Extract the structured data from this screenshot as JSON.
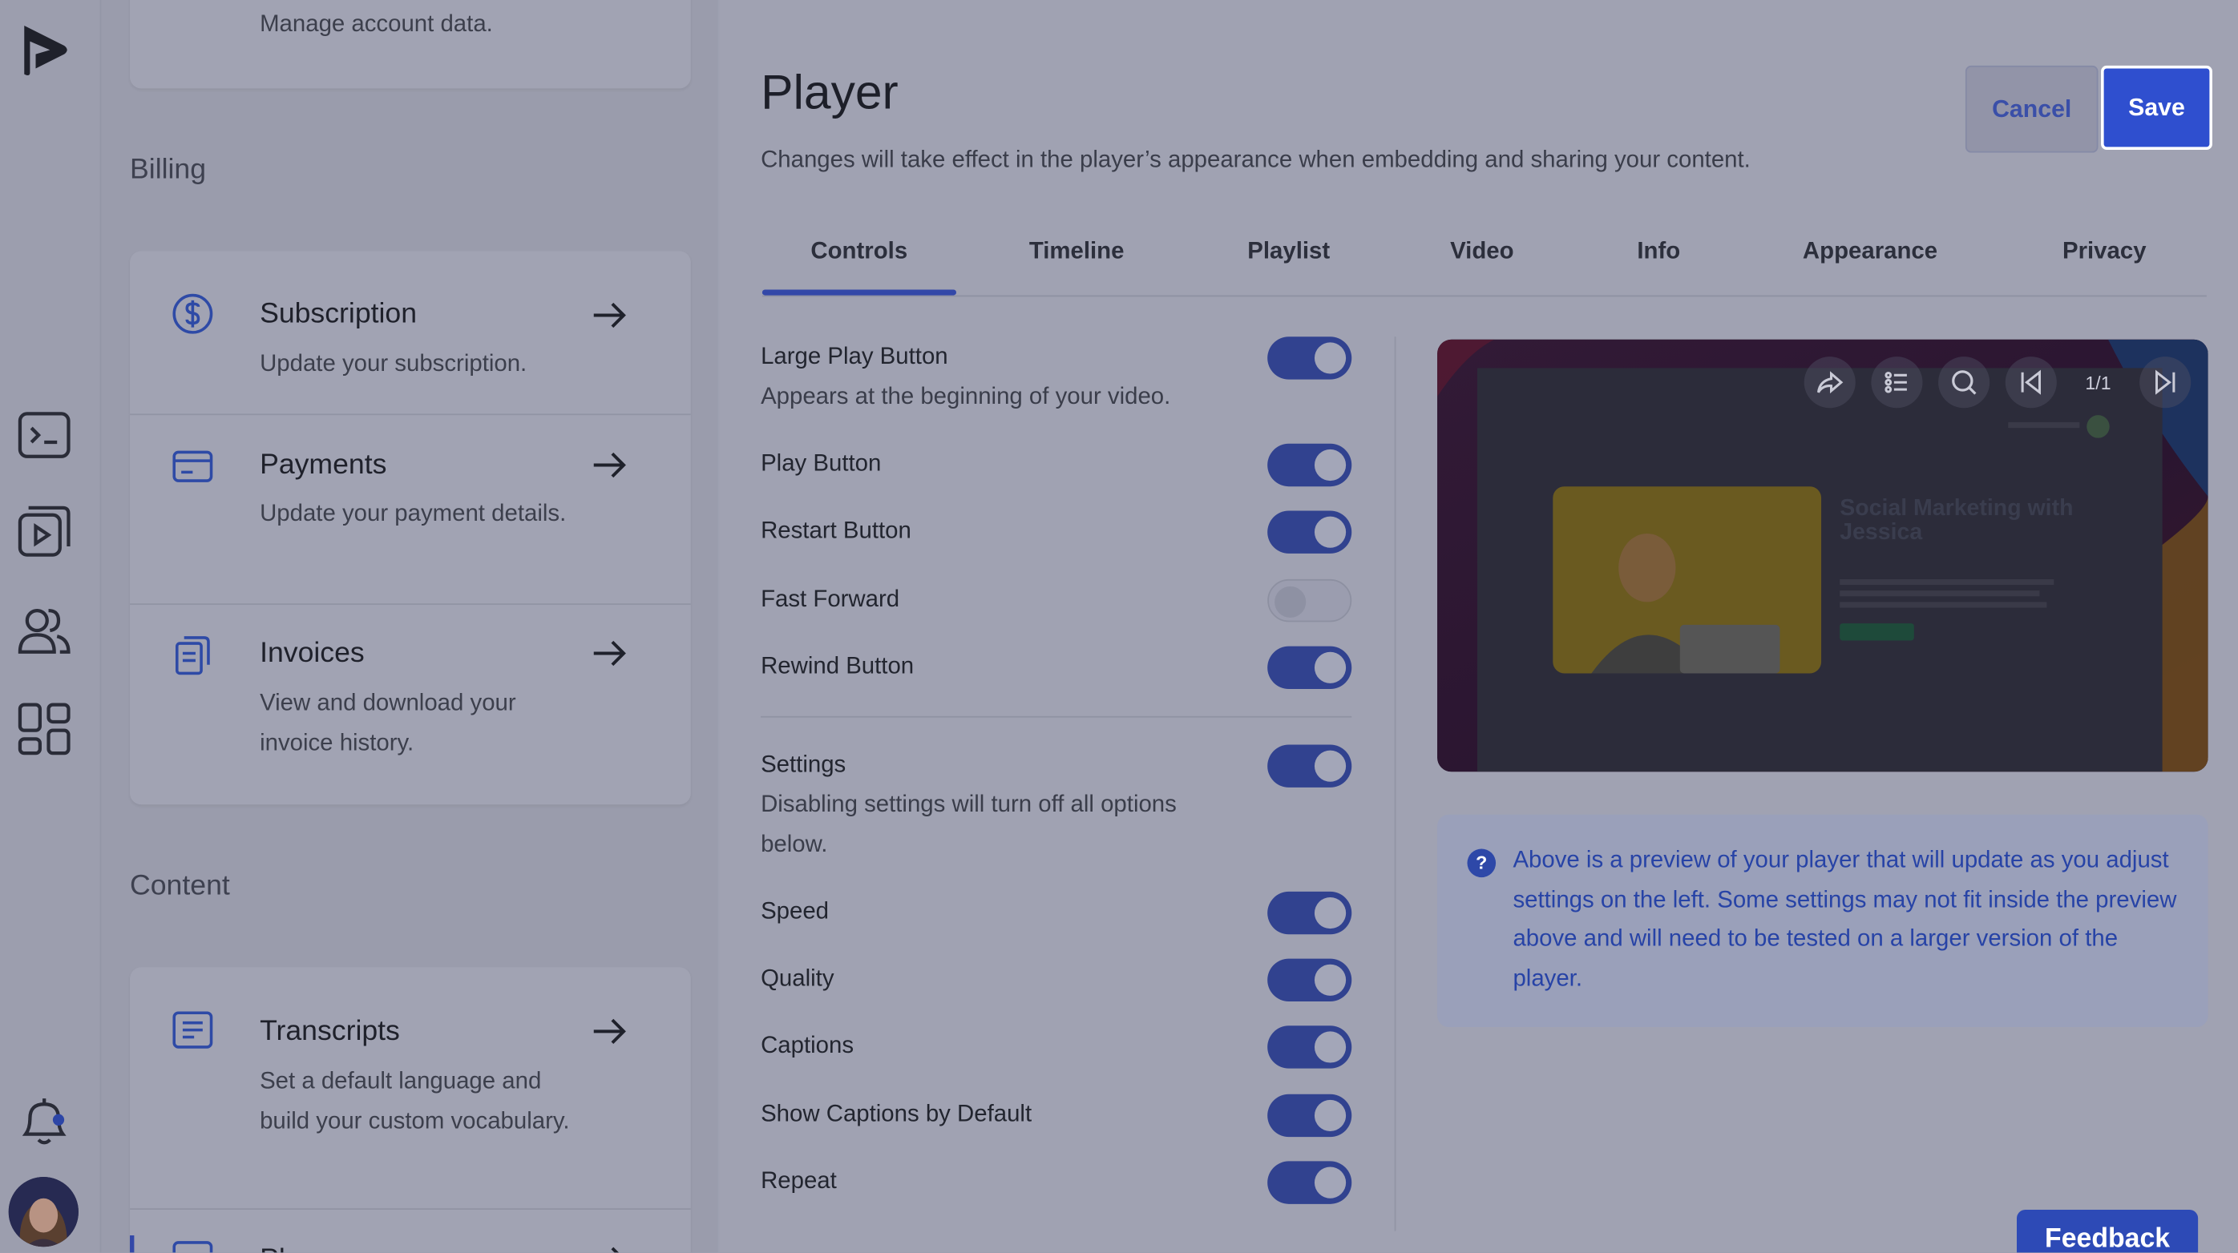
{
  "nav_left": {
    "account_item": {
      "desc": "Manage account data."
    },
    "billing_label": "Billing",
    "billing_items": [
      {
        "title": "Subscription",
        "desc": "Update your subscription."
      },
      {
        "title": "Payments",
        "desc": "Update your payment details."
      },
      {
        "title": "Invoices",
        "desc": "View and download your invoice history."
      }
    ],
    "content_label": "Content",
    "content_items": [
      {
        "title": "Transcripts",
        "desc": "Set a default language and build your custom vocabulary."
      },
      {
        "title": "Pl"
      }
    ]
  },
  "header": {
    "title": "Player",
    "subtitle": "Changes will take effect in the player’s appearance when embedding and sharing your content.",
    "cancel_label": "Cancel",
    "save_label": "Save"
  },
  "tabs": [
    "Controls",
    "Timeline",
    "Playlist",
    "Video",
    "Info",
    "Appearance",
    "Privacy"
  ],
  "active_tab": "Controls",
  "options": [
    {
      "label": "Large Play Button",
      "desc": "Appears at the beginning of your video.",
      "on": true
    },
    {
      "label": "Play Button",
      "on": true
    },
    {
      "label": "Restart Button",
      "on": true
    },
    {
      "label": "Fast Forward",
      "on": false
    },
    {
      "label": "Rewind Button",
      "on": true
    },
    {
      "label": "Settings",
      "desc": "Disabling settings will turn off all options below.",
      "on": true
    },
    {
      "label": "Speed",
      "on": true
    },
    {
      "label": "Quality",
      "on": true
    },
    {
      "label": "Captions",
      "on": true
    },
    {
      "label": "Show Captions by Default",
      "on": true
    },
    {
      "label": "Repeat",
      "on": true
    }
  ],
  "preview": {
    "counter": "1/1",
    "video_title": "Social Marketing with Jessica",
    "toolbar_icons": [
      "share-icon",
      "chapters-icon",
      "search-icon",
      "previous-icon",
      "next-icon"
    ]
  },
  "info_text": "Above is a preview of your player that will update as you adjust settings on the left. Some settings may not fit inside the preview above and will need to be tested on a larger version of the player.",
  "info_icon": "?",
  "feedback_label": "Feedback",
  "colors": {
    "accent": "#2f4fcf",
    "toggle_on": "#31428f",
    "info_text": "#2743a6",
    "background": "#a0a2b2"
  }
}
